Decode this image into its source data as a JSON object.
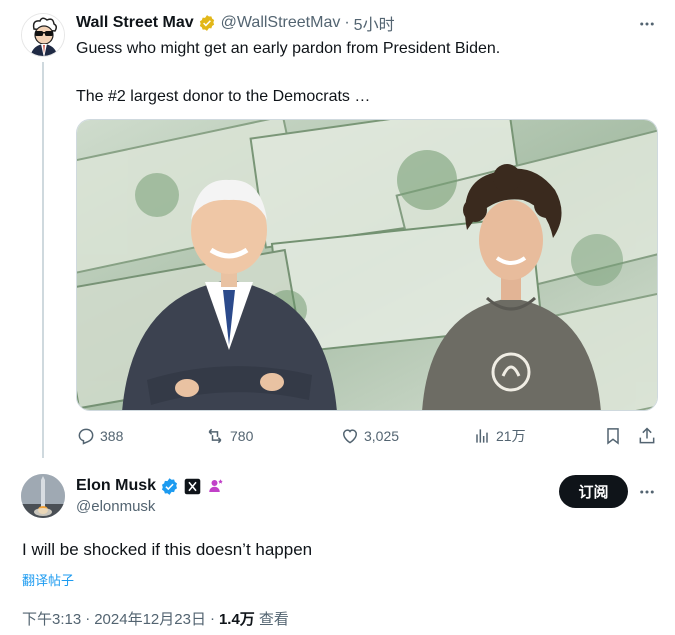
{
  "tweet1": {
    "author_name": "Wall Street Mav",
    "handle": "@WallStreetMav",
    "separator": "·",
    "time_ago": "5小时",
    "text_line1": "Guess who might get an early pardon from President Biden.",
    "text_line2": "The #2 largest donor to the Democrats …",
    "media_icon": "photo-of-two-men-over-dollar-bills",
    "stats": {
      "replies": "388",
      "reposts": "780",
      "likes": "3,025",
      "views": "21万"
    }
  },
  "tweet2": {
    "author_name": "Elon Musk",
    "handle": "@elonmusk",
    "subscribe_label": "订阅",
    "text": "I will be shocked if this doesn’t happen",
    "translate_label": "翻译帖子",
    "time": "下午3:13",
    "separator": "·",
    "date": "2024年12月23日",
    "separator2": "·",
    "views_count": "1.4万",
    "views_label": "查看"
  },
  "colors": {
    "accent": "#1d9bf0",
    "verified_gold": "#e2b719",
    "verified_blue": "#1d9bf0",
    "muted": "#536471",
    "text": "#0f1419"
  }
}
